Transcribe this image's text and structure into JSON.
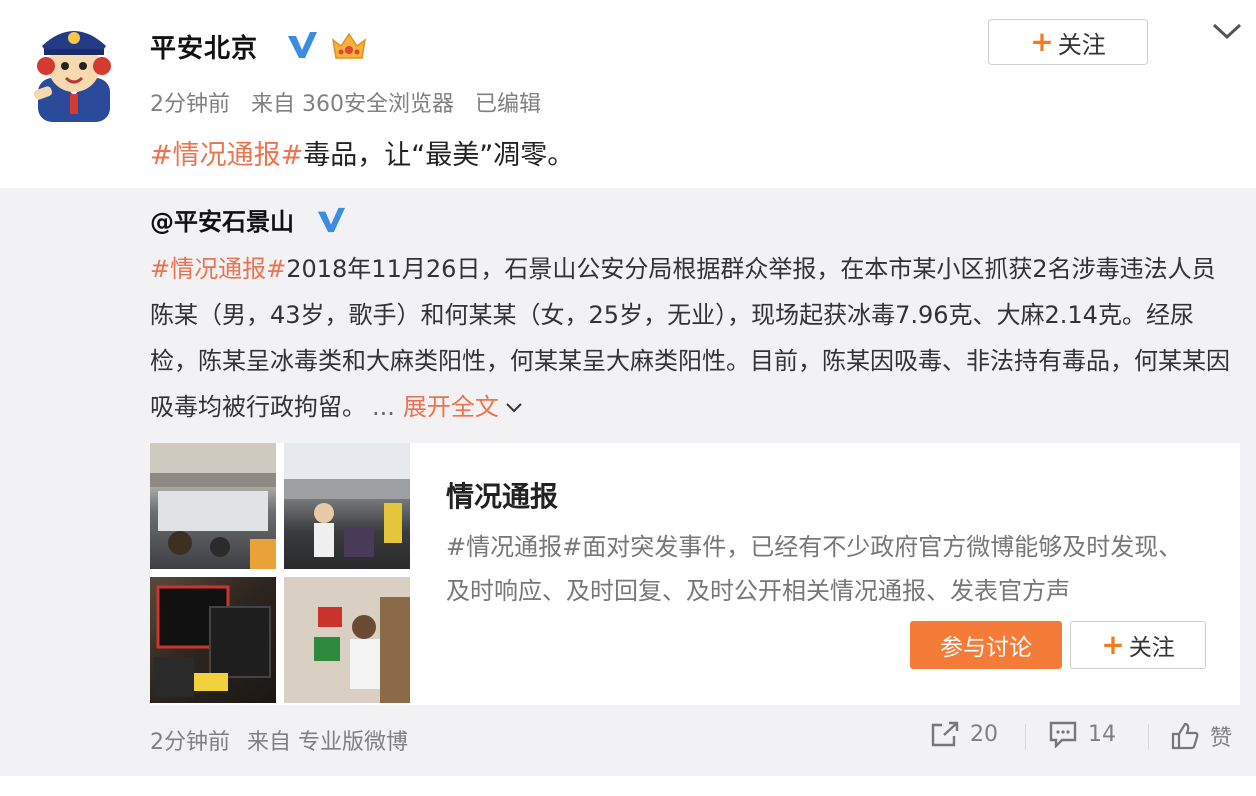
{
  "post": {
    "username": "平安北京",
    "follow_label": "关注",
    "meta": {
      "time": "2分钟前",
      "source": "来自 360安全浏览器",
      "edited": "已编辑"
    },
    "text": {
      "hashtag": "#情况通报#",
      "body": "毒品，让“最美”凋零。"
    }
  },
  "repost": {
    "username": "@平安石景山",
    "hashtag": "#情况通报#",
    "text": "2018年11月26日，石景山公安分局根据群众举报，在本市某小区抓获2名涉毒违法人员陈某（男，43岁，歌手）和何某某（女，25岁，无业），现场起获冰毒7.96克、大麻2.14克。经尿检，陈某呈冰毒类和大麻类阳性，何某某呈大麻类阳性。目前，陈某因吸毒、非法持有毒品，何某某因吸毒均被行政拘留。",
    "ellipsis": "...",
    "expand_label": "展开全文",
    "topic_card": {
      "title": "情况通报",
      "desc_hashtag": "#情况通报#",
      "desc": "面对突发事件，已经有不少政府官方微博能够及时发现、及时响应、及时回复、及时公开相关情况通报、发表官方声",
      "discuss_label": "参与讨论",
      "follow_label": "关注"
    },
    "footer": {
      "time": "2分钟前",
      "source": "来自 专业版微博",
      "share_count": "20",
      "comment_count": "14",
      "like_label": "赞"
    }
  },
  "colors": {
    "accent": "#eb7350",
    "discuss_button": "#f47c38",
    "repost_bg": "#f2f2f5"
  }
}
